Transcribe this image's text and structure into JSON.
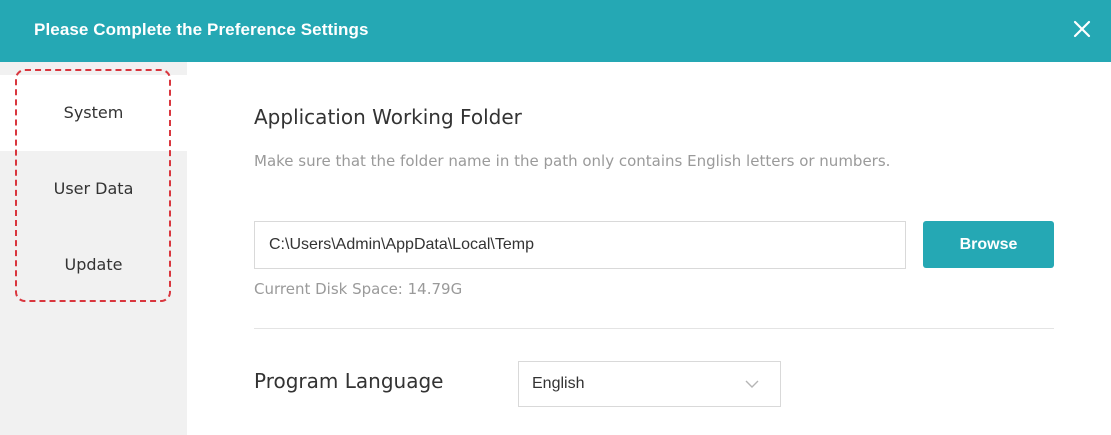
{
  "dialog": {
    "title": "Please Complete the Preference Settings",
    "close_icon": "close-icon",
    "accent_color": "#25a8b4"
  },
  "sidebar": {
    "items": [
      {
        "label": "System",
        "active": true
      },
      {
        "label": "User Data",
        "active": false
      },
      {
        "label": "Update",
        "active": false
      }
    ],
    "highlight_color": "#d9363e"
  },
  "working_folder": {
    "title": "Application Working Folder",
    "hint": "Make sure that the folder name in the path only contains English letters or numbers.",
    "path_value": "C:\\Users\\Admin\\AppData\\Local\\Temp",
    "browse_label": "Browse",
    "disk_space": "Current Disk Space: 14.79G"
  },
  "language": {
    "label": "Program Language",
    "selected": "English",
    "dropdown_icon": "chevron-down-icon"
  }
}
